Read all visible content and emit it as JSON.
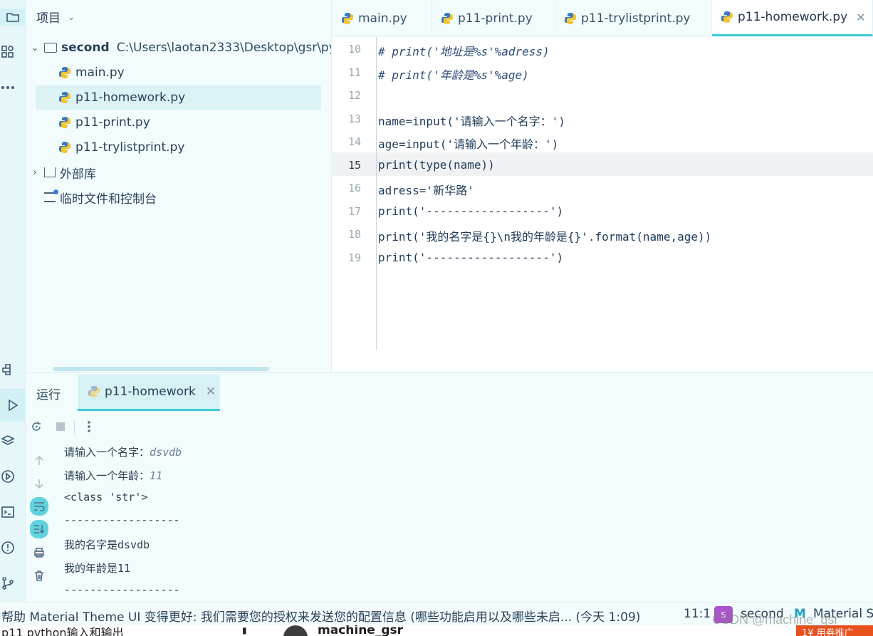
{
  "project_panel": {
    "title": "项目",
    "root_name": "second",
    "root_path": "C:\\Users\\laotan2333\\Desktop\\gsr\\py",
    "files": [
      "main.py",
      "p11-homework.py",
      "p11-print.py",
      "p11-trylistprint.py"
    ],
    "selected_file": "p11-homework.py",
    "external_libs": "外部库",
    "scratches": "临时文件和控制台"
  },
  "editor_tabs": [
    {
      "label": "main.py",
      "active": false
    },
    {
      "label": "p11-print.py",
      "active": false
    },
    {
      "label": "p11-trylistprint.py",
      "active": false
    },
    {
      "label": "p11-homework.py",
      "active": true
    }
  ],
  "editor": {
    "current_line": "15",
    "lines": [
      {
        "n": "10",
        "text": "# print('地址是%s'%adress)"
      },
      {
        "n": "11",
        "text": "# print('年龄是%s'%age)"
      },
      {
        "n": "12",
        "text": ""
      },
      {
        "n": "13",
        "text": "name=input('请输入一个名字：')"
      },
      {
        "n": "14",
        "text": "age=input('请输入一个年龄：')"
      },
      {
        "n": "15",
        "text": "print(type(name))"
      },
      {
        "n": "16",
        "text": "adress='新华路'"
      },
      {
        "n": "17",
        "text": "print('------------------')"
      },
      {
        "n": "18",
        "text": "print('我的名字是{}\\n我的年龄是{}'.format(name,age))"
      },
      {
        "n": "19",
        "text": "print('------------------')"
      }
    ]
  },
  "run_panel": {
    "label": "运行",
    "tab_label": "p11-homework",
    "output": [
      {
        "prompt": "请输入一个名字：",
        "input": "dsvdb"
      },
      {
        "prompt": "请输入一个年龄：",
        "input": "11"
      },
      {
        "prompt": "<class 'str'>",
        "input": ""
      },
      {
        "prompt": "------------------",
        "input": ""
      },
      {
        "prompt": "我的名字是dsvdb",
        "input": ""
      },
      {
        "prompt": "我的年龄是11",
        "input": ""
      },
      {
        "prompt": "------------------",
        "input": ""
      }
    ]
  },
  "status_bar": {
    "message": "帮助 Material Theme UI 变得更好: 我们需要您的授权来发送您的配置信息 (哪些功能启用以及哪些未启... (今天 1:09)",
    "position": "11:1",
    "project": "second",
    "theme": "Material S"
  },
  "bottom_strip": {
    "title": "p11 python输入和输出",
    "user": "machine_gsr",
    "button": "1¥ 用券推广"
  },
  "watermark": "CSDN @machine_gsr"
}
